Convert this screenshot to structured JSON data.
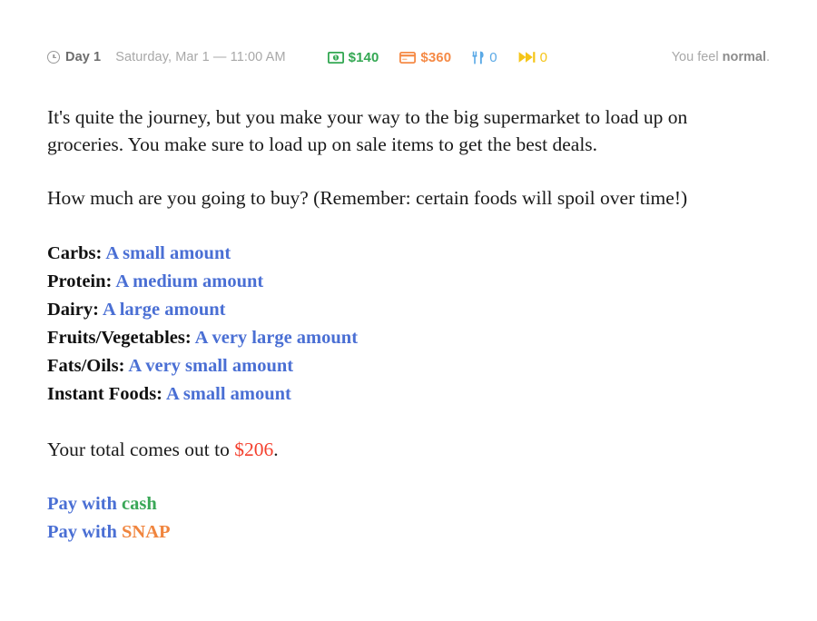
{
  "status": {
    "clock_icon": "clock-icon",
    "day": "Day 1",
    "date": "Saturday, Mar 1 — 11:00 AM",
    "meters": [
      {
        "icon": "banknote-icon",
        "name": "cash",
        "value": "$140",
        "color": "#34a853"
      },
      {
        "icon": "credit-card-icon",
        "name": "card",
        "value": "$360",
        "color": "#f58a46"
      },
      {
        "icon": "fork-knife-icon",
        "name": "food",
        "value": "0",
        "color": "#5aa9e6"
      },
      {
        "icon": "fast-forward-icon",
        "name": "energy",
        "value": "0",
        "color": "#f5c518"
      }
    ],
    "feeling_prefix": "You feel ",
    "feeling_value": "normal",
    "feeling_suffix": "."
  },
  "narrative": "It's quite the journey, but you make your way to the big supermarket to load up on groceries. You make sure to load up on sale items to get the best deals.",
  "question": "How much are you going to buy? (Remember: certain foods will spoil over time!)",
  "choices": [
    {
      "label": "Carbs:",
      "value": "A small amount"
    },
    {
      "label": "Protein:",
      "value": "A medium amount"
    },
    {
      "label": "Dairy:",
      "value": "A large amount"
    },
    {
      "label": "Fruits/Vegetables:",
      "value": "A very large amount"
    },
    {
      "label": "Fats/Oils:",
      "value": "A very small amount"
    },
    {
      "label": "Instant Foods:",
      "value": "A small amount"
    }
  ],
  "total": {
    "prefix": "Your total comes out to ",
    "amount": "$206",
    "suffix": "."
  },
  "actions": [
    {
      "prefix": "Pay with ",
      "method": "cash",
      "style": "cash"
    },
    {
      "prefix": "Pay with ",
      "method": "SNAP",
      "style": "snap"
    }
  ],
  "colors": {
    "accent_blue": "#4a6fd4",
    "cash_green": "#3aa757",
    "snap_orange": "#f0853e",
    "total_red": "#f4402e"
  }
}
